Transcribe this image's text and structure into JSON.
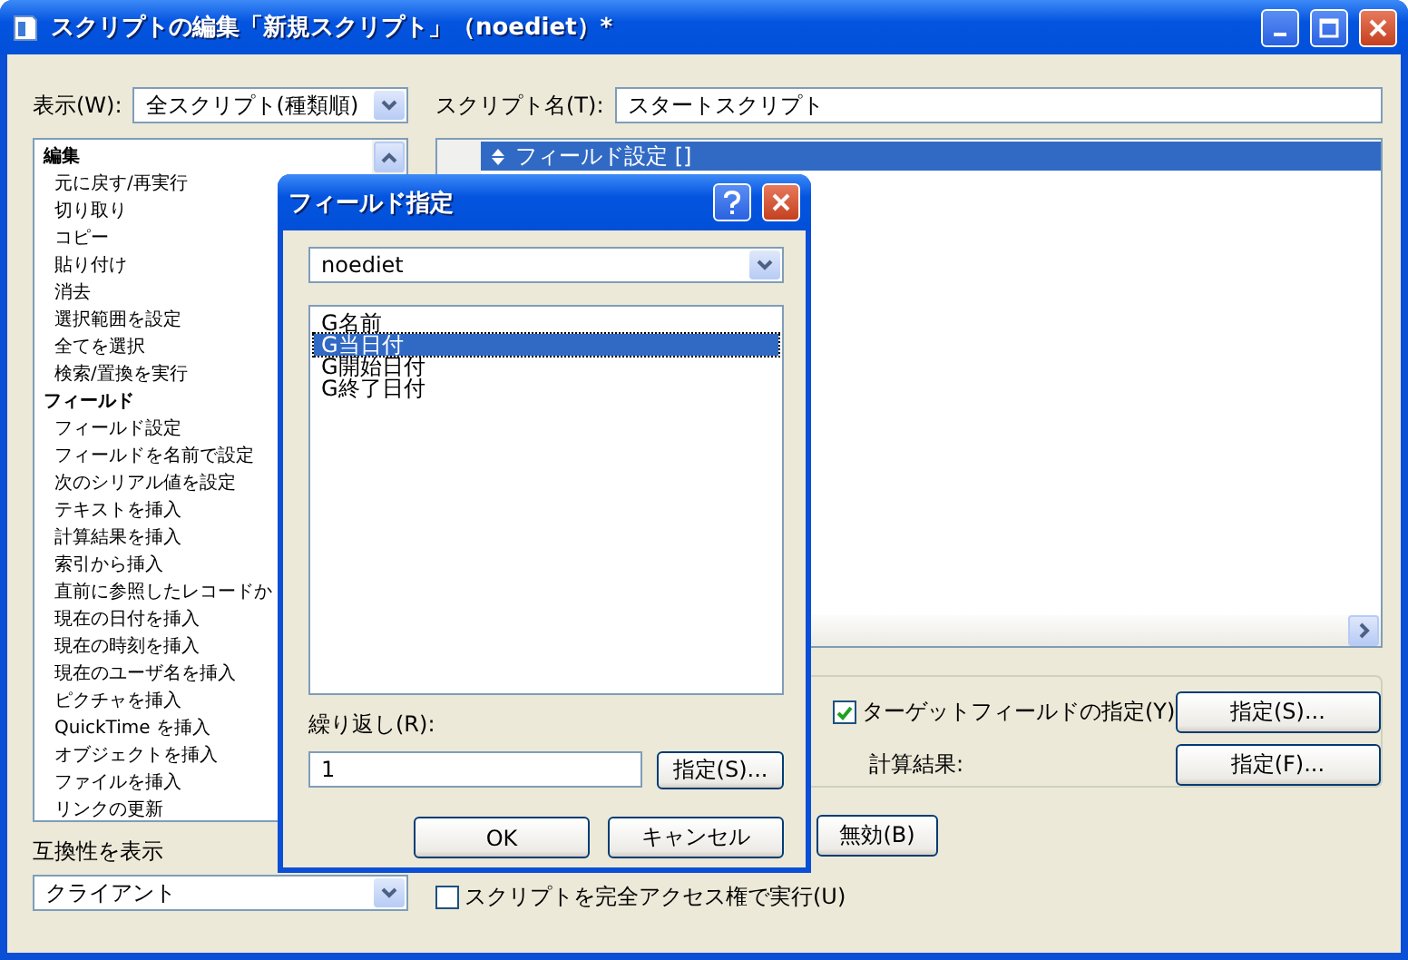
{
  "window": {
    "title": "スクリプトの編集「新規スクリプト」（noediet）*"
  },
  "view": {
    "label": "表示(W):",
    "value": "全スクリプト(種類順)"
  },
  "script_name": {
    "label": "スクリプト名(T):",
    "value": "スタートスクリプト"
  },
  "commands": [
    {
      "label": "編集",
      "kind": "heading"
    },
    {
      "label": "元に戻す/再実行",
      "kind": "item"
    },
    {
      "label": "切り取り",
      "kind": "item"
    },
    {
      "label": "コピー",
      "kind": "item"
    },
    {
      "label": "貼り付け",
      "kind": "item"
    },
    {
      "label": "消去",
      "kind": "item"
    },
    {
      "label": "選択範囲を設定",
      "kind": "item"
    },
    {
      "label": "全てを選択",
      "kind": "item"
    },
    {
      "label": "検索/置換を実行",
      "kind": "item"
    },
    {
      "label": "フィールド",
      "kind": "heading"
    },
    {
      "label": "フィールド設定",
      "kind": "item"
    },
    {
      "label": "フィールドを名前で設定",
      "kind": "item"
    },
    {
      "label": "次のシリアル値を設定",
      "kind": "item"
    },
    {
      "label": "テキストを挿入",
      "kind": "item"
    },
    {
      "label": "計算結果を挿入",
      "kind": "item"
    },
    {
      "label": "索引から挿入",
      "kind": "item"
    },
    {
      "label": "直前に参照したレコードか",
      "kind": "item"
    },
    {
      "label": "現在の日付を挿入",
      "kind": "item"
    },
    {
      "label": "現在の時刻を挿入",
      "kind": "item"
    },
    {
      "label": "現在のユーザ名を挿入",
      "kind": "item"
    },
    {
      "label": "ピクチャを挿入",
      "kind": "item"
    },
    {
      "label": "QuickTime を挿入",
      "kind": "item"
    },
    {
      "label": "オブジェクトを挿入",
      "kind": "item"
    },
    {
      "label": "ファイルを挿入",
      "kind": "item"
    },
    {
      "label": "リンクの更新",
      "kind": "item"
    }
  ],
  "compat": {
    "label": "互換性を表示",
    "value": "クライアント"
  },
  "steps": [
    {
      "label": "フィールド設定 []",
      "selected": true
    }
  ],
  "options": {
    "target": {
      "label": "ターゲットフィールドの指定(Y)",
      "checked": true,
      "button": "指定(S)..."
    },
    "calc": {
      "label": "計算結果:",
      "button": "指定(F)..."
    }
  },
  "disable_button": "無効(B)",
  "full_access": {
    "label": "スクリプトを完全アクセス権で実行(U)",
    "checked": false
  },
  "dialog": {
    "title": "フィールド指定",
    "table": "noediet",
    "fields": [
      {
        "label": "G名前",
        "selected": false
      },
      {
        "label": "G当日付",
        "selected": true
      },
      {
        "label": "G開始日付",
        "selected": false
      },
      {
        "label": "G終了日付",
        "selected": false
      }
    ],
    "repeat": {
      "label": "繰り返し(R):",
      "value": "1",
      "button": "指定(S)..."
    },
    "buttons": [
      "OK",
      "キャンセル"
    ]
  }
}
